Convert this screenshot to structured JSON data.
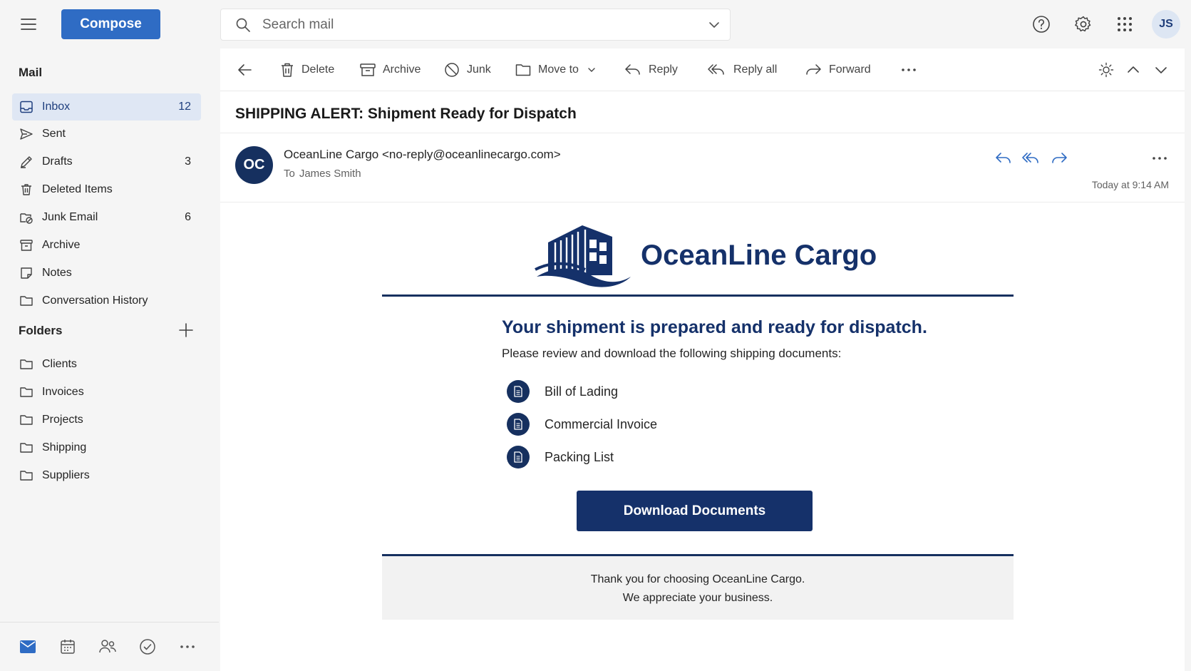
{
  "topbar": {
    "compose_label": "Compose",
    "search_placeholder": "Search mail",
    "avatar_initials": "JS"
  },
  "sidebar": {
    "mail_heading": "Mail",
    "items": [
      {
        "label": "Inbox",
        "count": "12",
        "icon": "inbox-icon"
      },
      {
        "label": "Sent",
        "count": "",
        "icon": "send-icon"
      },
      {
        "label": "Drafts",
        "count": "3",
        "icon": "pencil-icon"
      },
      {
        "label": "Deleted Items",
        "count": "",
        "icon": "trash-icon"
      },
      {
        "label": "Junk Email",
        "count": "6",
        "icon": "junk-icon"
      },
      {
        "label": "Archive",
        "count": "",
        "icon": "archive-icon"
      },
      {
        "label": "Notes",
        "count": "",
        "icon": "note-icon"
      },
      {
        "label": "Conversation History",
        "count": "",
        "icon": "folder-icon"
      }
    ],
    "folders_heading": "Folders",
    "folders": [
      {
        "label": "Clients"
      },
      {
        "label": "Invoices"
      },
      {
        "label": "Projects"
      },
      {
        "label": "Shipping"
      },
      {
        "label": "Suppliers"
      }
    ]
  },
  "toolbar": {
    "delete_label": "Delete",
    "archive_label": "Archive",
    "junk_label": "Junk",
    "move_label": "Move to",
    "reply_label": "Reply",
    "reply_all_label": "Reply all",
    "forward_label": "Forward"
  },
  "message": {
    "subject": "SHIPPING ALERT: Shipment Ready for Dispatch",
    "sender_initials": "OC",
    "sender": "OceanLine Cargo <no-reply@oceanlinecargo.com>",
    "to_prefix": "To",
    "to_name": "James Smith",
    "time": "Today at 9:14 AM"
  },
  "email_body": {
    "brand_name": "OceanLine Cargo",
    "headline": "Your shipment is prepared and ready for dispatch.",
    "intro": "Please review and download the following shipping documents:",
    "documents": [
      {
        "label": "Bill of Lading"
      },
      {
        "label": "Commercial Invoice"
      },
      {
        "label": "Packing List"
      }
    ],
    "download_label": "Download Documents",
    "footer_line1": "Thank you for choosing OceanLine Cargo.",
    "footer_line2": "We appreciate your business."
  },
  "colors": {
    "accent": "#2f6cc4",
    "brand_navy": "#15316a",
    "active_bg": "#dfe7f4"
  }
}
